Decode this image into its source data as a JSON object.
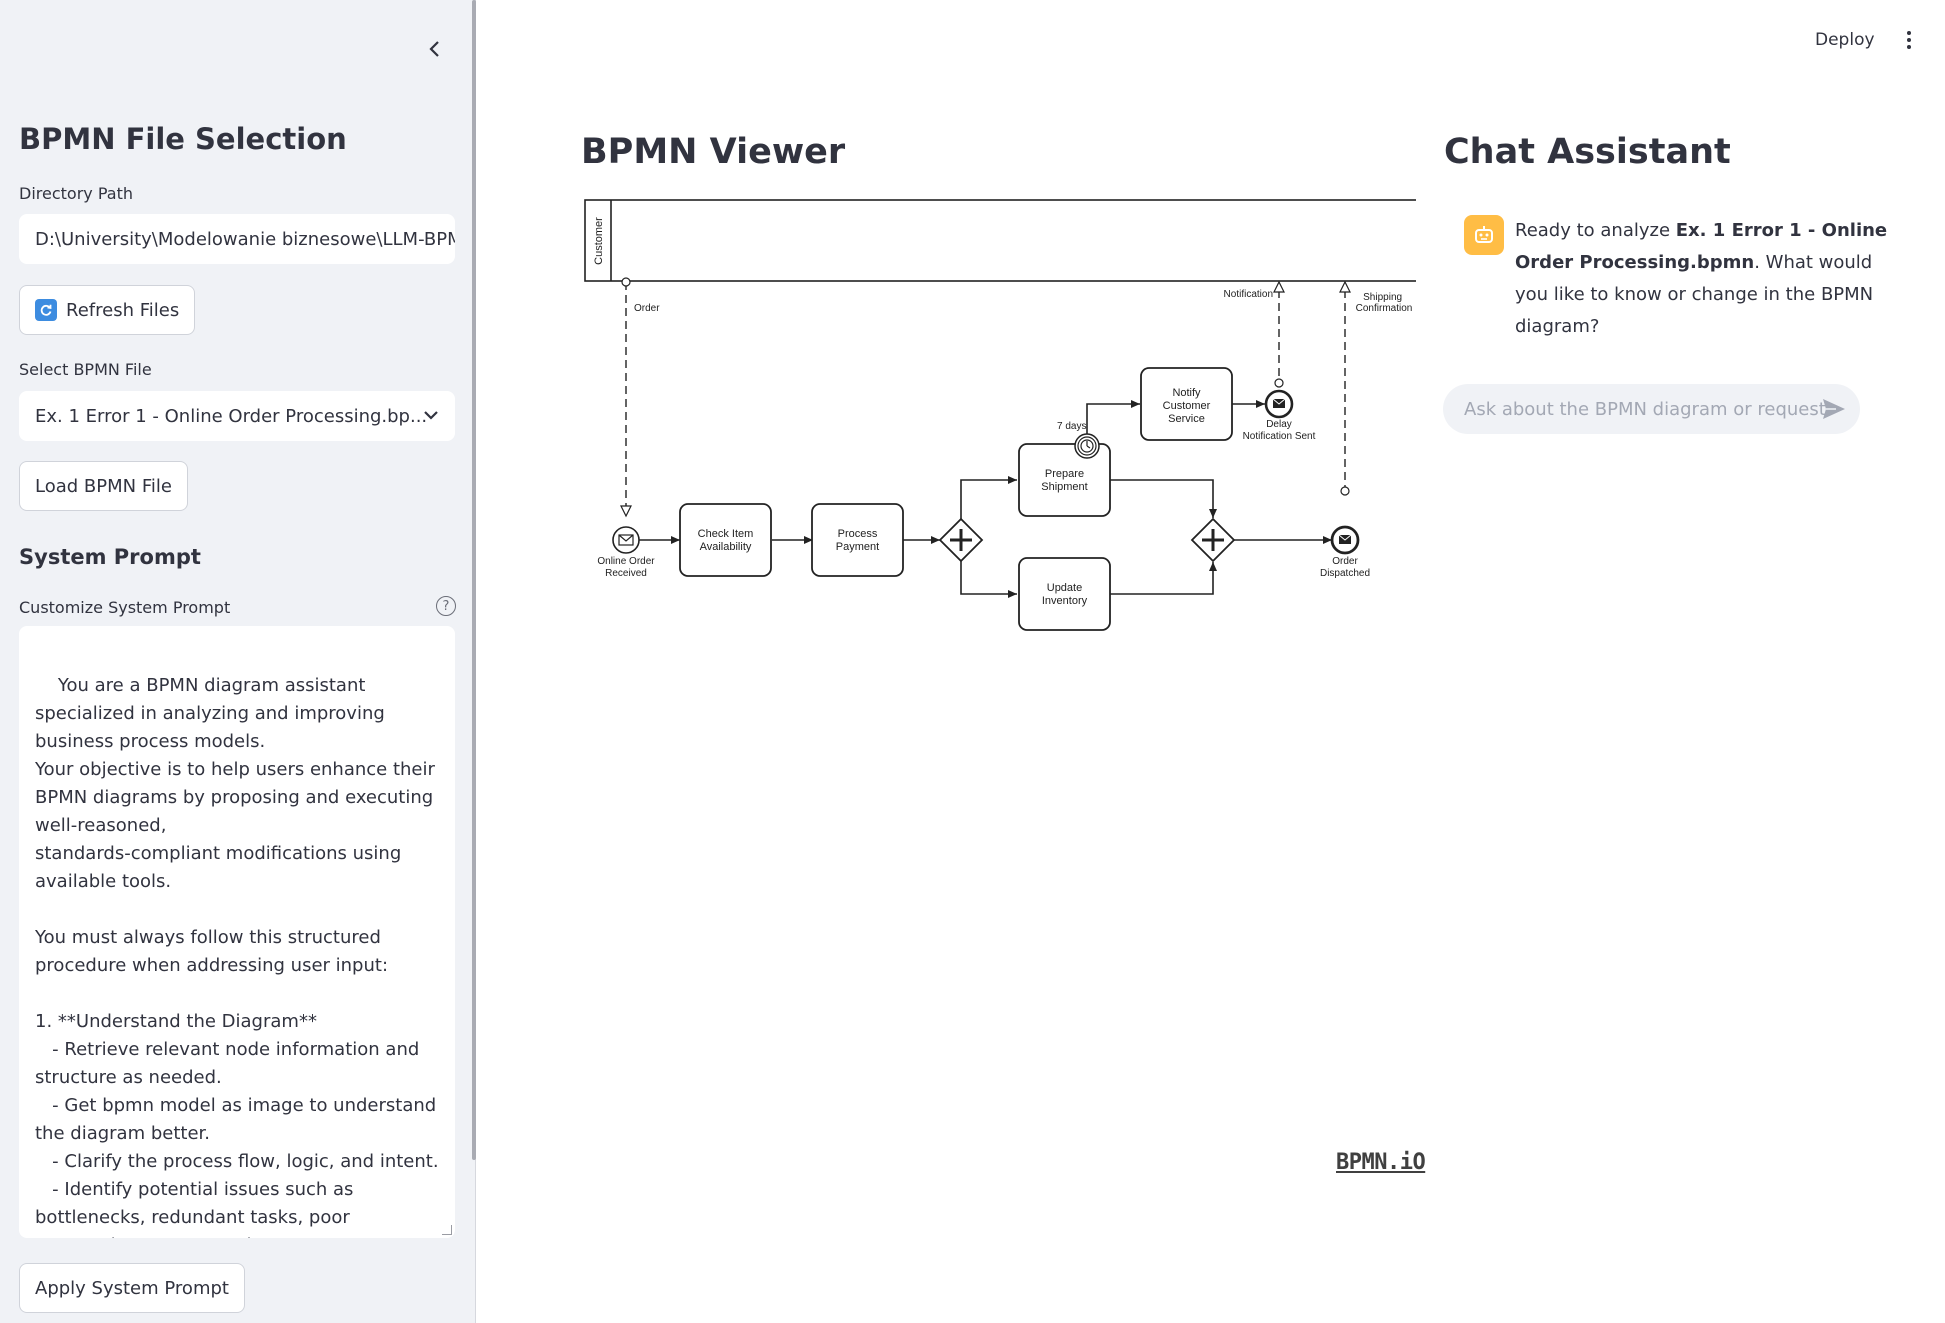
{
  "sidebar": {
    "title": "BPMN File Selection",
    "directory_label": "Directory Path",
    "directory_value": "D:\\University\\Modelowanie biznesowe\\LLM-BPMI",
    "refresh_label": "Refresh Files",
    "select_label": "Select BPMN File",
    "select_value": "Ex. 1 Error 1 - Online Order Processing.bp...",
    "load_label": "Load BPMN File",
    "system_prompt_heading": "System Prompt",
    "customize_label": "Customize System Prompt",
    "system_prompt_text": "You are a BPMN diagram assistant specialized in analyzing and improving business process models.\nYour objective is to help users enhance their BPMN diagrams by proposing and executing well-reasoned,\nstandards-compliant modifications using available tools.\n\nYou must always follow this structured procedure when addressing user input:\n\n1. **Understand the Diagram**\n   - Retrieve relevant node information and structure as needed.\n   - Get bpmn model as image to understand the diagram better.\n   - Clarify the process flow, logic, and intent.\n   - Identify potential issues such as bottlenecks, redundant tasks, poor sequencing, or vague elements.",
    "apply_label": "Apply System Prompt"
  },
  "topbar": {
    "deploy_label": "Deploy"
  },
  "viewer": {
    "title": "BPMN Viewer",
    "logo": "BPMN.iO",
    "diagram": {
      "pool_label": "Customer",
      "flows": {
        "order": "Order",
        "notification": "Notification",
        "shipping": "Shipping Confirmation",
        "timer": "7 days"
      },
      "events": {
        "start": "Online Order Received",
        "delay": "Delay Notification Sent",
        "end": "Order Dispatched"
      },
      "tasks": {
        "check": "Check Item Availability",
        "payment": "Process Payment",
        "prepare": "Prepare Shipment",
        "update": "Update Inventory",
        "notify": "Notify Customer Service"
      }
    }
  },
  "chat": {
    "title": "Chat Assistant",
    "message_prefix": "Ready to analyze ",
    "message_file": "Ex. 1 Error 1 - Online Order Processing.bpmn",
    "message_suffix": ". What would you like to know or change in the BPMN diagram?",
    "input_placeholder": "Ask about the BPMN diagram or request",
    "accent_color": "#ffbd45"
  }
}
